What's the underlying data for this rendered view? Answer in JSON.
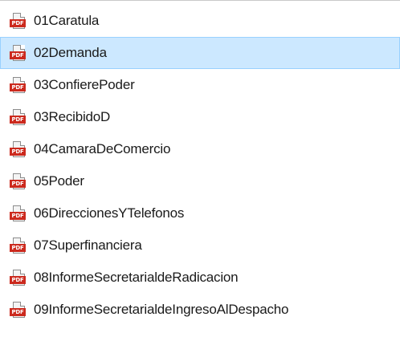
{
  "icon_badge_text": "PDF",
  "colors": {
    "selection_fill": "#cce8ff",
    "selection_border": "#99d1ff",
    "pdf_badge": "#cc2a1e"
  },
  "files": [
    {
      "name": "01Caratula",
      "icon": "pdf-file-icon",
      "selected": false
    },
    {
      "name": "02Demanda",
      "icon": "pdf-file-icon",
      "selected": true
    },
    {
      "name": "03ConfierePoder",
      "icon": "pdf-file-icon",
      "selected": false
    },
    {
      "name": "03RecibidoD",
      "icon": "pdf-file-icon",
      "selected": false
    },
    {
      "name": "04CamaraDeComercio",
      "icon": "pdf-file-icon",
      "selected": false
    },
    {
      "name": "05Poder",
      "icon": "pdf-file-icon",
      "selected": false
    },
    {
      "name": "06DireccionesYTelefonos",
      "icon": "pdf-file-icon",
      "selected": false
    },
    {
      "name": "07Superfinanciera",
      "icon": "pdf-file-icon",
      "selected": false
    },
    {
      "name": "08InformeSecretarialdeRadicacion",
      "icon": "pdf-file-icon",
      "selected": false
    },
    {
      "name": "09InformeSecretarialdeIngresoAlDespacho",
      "icon": "pdf-file-icon",
      "selected": false
    }
  ]
}
